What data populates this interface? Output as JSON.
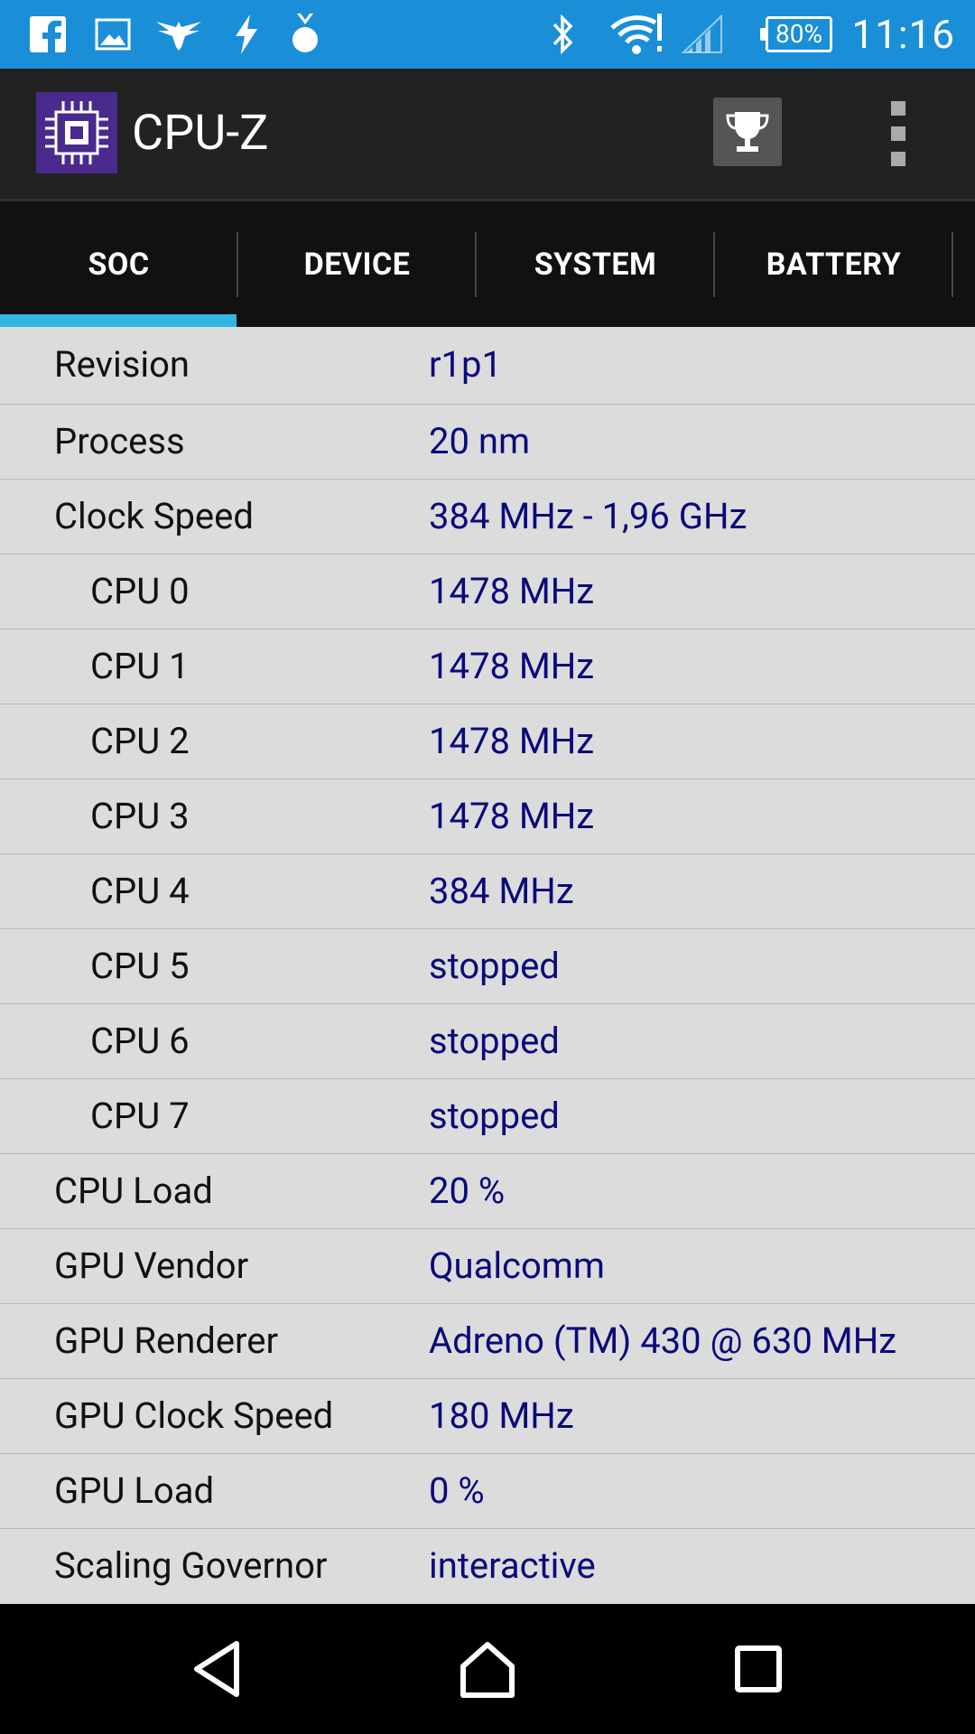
{
  "status_bar": {
    "time": "11:16",
    "battery_percent": "80%",
    "left_icons": [
      "facebook-icon",
      "image-icon",
      "eagle-icon",
      "bolt-icon",
      "medal-icon"
    ],
    "right_icons": [
      "bluetooth-icon",
      "wifi-alert-icon",
      "signal-icon"
    ],
    "color": "#1a8fd8"
  },
  "app_bar": {
    "title": "CPU-Z",
    "logo_icon": "cpu-chip-icon",
    "actions": [
      "trophy-icon",
      "overflow-menu-icon"
    ]
  },
  "tabs": [
    {
      "label": "SOC",
      "active": true
    },
    {
      "label": "DEVICE",
      "active": false
    },
    {
      "label": "SYSTEM",
      "active": false
    },
    {
      "label": "BATTERY",
      "active": false
    }
  ],
  "accent_color": "#33b5e5",
  "rows": [
    {
      "label": "Revision",
      "value": "r1p1"
    },
    {
      "label": "Process",
      "value": "20 nm"
    },
    {
      "label": "Clock Speed",
      "value": "384 MHz - 1,96 GHz"
    },
    {
      "label": "CPU 0",
      "value": "1478 MHz"
    },
    {
      "label": "CPU 1",
      "value": "1478 MHz"
    },
    {
      "label": "CPU 2",
      "value": "1478 MHz"
    },
    {
      "label": "CPU 3",
      "value": "1478 MHz"
    },
    {
      "label": "CPU 4",
      "value": "384 MHz"
    },
    {
      "label": "CPU 5",
      "value": "stopped"
    },
    {
      "label": "CPU 6",
      "value": "stopped"
    },
    {
      "label": "CPU 7",
      "value": "stopped"
    },
    {
      "label": "CPU Load",
      "value": "20 %"
    },
    {
      "label": "GPU Vendor",
      "value": "Qualcomm"
    },
    {
      "label": "GPU Renderer",
      "value": "Adreno (TM) 430 @ 630 MHz"
    },
    {
      "label": "GPU Clock Speed",
      "value": "180 MHz"
    },
    {
      "label": "GPU Load",
      "value": "0 %"
    },
    {
      "label": "Scaling Governor",
      "value": "interactive"
    }
  ],
  "nav_bar": [
    "back-icon",
    "home-icon",
    "recents-icon"
  ]
}
